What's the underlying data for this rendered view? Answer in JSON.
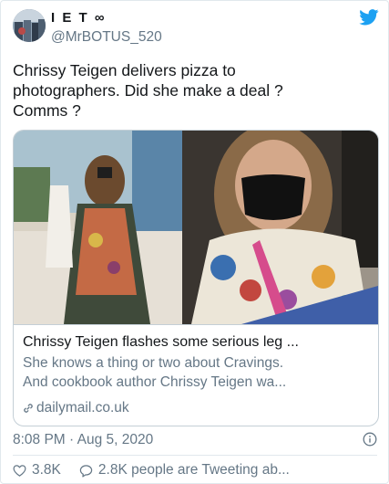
{
  "tweet": {
    "display_name": "I E T ∞",
    "username": "@MrBOTUS_520",
    "text": "Chrissy Teigen delivers pizza to\nphotographers. Did she make a deal  ?\nComms ?",
    "timestamp": "8:08 PM · Aug 5, 2020"
  },
  "link_card": {
    "title": "Chrissy Teigen flashes some serious leg ...",
    "description": "She knows a thing or two about Cravings.\nAnd cookbook author Chrissy Teigen wa...",
    "domain": "dailymail.co.uk"
  },
  "actions": {
    "likes": "3.8K",
    "conversation": "2.8K people are Tweeting ab..."
  },
  "icons": {
    "brand": "twitter-bird-icon",
    "link": "link-icon",
    "info": "info-icon",
    "like": "heart-icon",
    "reply": "speech-bubble-icon"
  },
  "colors": {
    "twitter_blue": "#1da1f2",
    "text": "#14171a",
    "secondary_text": "#657786",
    "border": "#c4cfd6"
  }
}
